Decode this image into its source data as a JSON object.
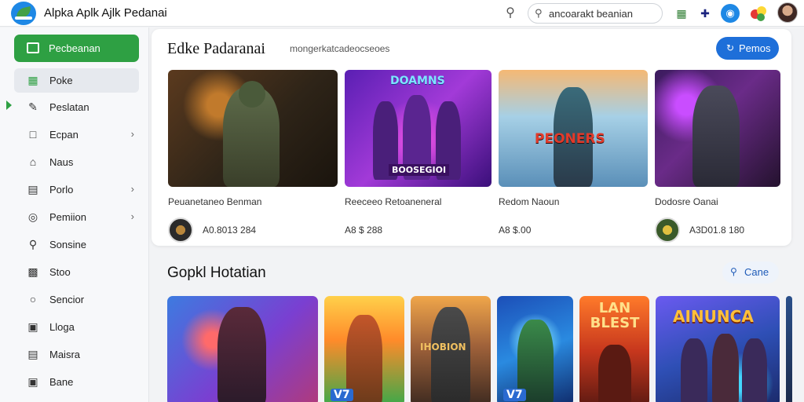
{
  "app": {
    "title": "Alpka Aplk Ajlk Pedanai"
  },
  "topbar": {
    "search_placeholder": "ancoarakt beanian",
    "icons": [
      "search-icon",
      "chart-icon",
      "move-icon",
      "app-circle-icon",
      "colors-icon"
    ],
    "accent": "#1e88e5"
  },
  "sidebar": {
    "primary": {
      "label": "Pecbeanan",
      "color": "#2ea043"
    },
    "items": [
      {
        "label": "Poke",
        "icon": "grid-icon",
        "active": true,
        "chevron": false
      },
      {
        "label": "Peslatan",
        "icon": "edit-icon",
        "active": false,
        "chevron": false
      },
      {
        "label": "Ecpan",
        "icon": "doc-icon",
        "active": false,
        "chevron": true
      },
      {
        "label": "Naus",
        "icon": "home-icon",
        "active": false,
        "chevron": false
      },
      {
        "label": "Porlo",
        "icon": "list-icon",
        "active": false,
        "chevron": true
      },
      {
        "label": "Pemiion",
        "icon": "target-icon",
        "active": false,
        "chevron": true
      },
      {
        "label": "Sonsine",
        "icon": "pin-icon",
        "active": false,
        "chevron": false
      },
      {
        "label": "Stoo",
        "icon": "building-icon",
        "active": false,
        "chevron": false
      },
      {
        "label": "Sencior",
        "icon": "user-icon",
        "active": false,
        "chevron": false
      },
      {
        "label": "Lloga",
        "icon": "image-icon",
        "active": false,
        "chevron": false
      },
      {
        "label": "Maisra",
        "icon": "file-icon",
        "active": false,
        "chevron": false
      },
      {
        "label": "Bane",
        "icon": "cube-icon",
        "active": false,
        "chevron": false
      }
    ]
  },
  "featured": {
    "title": "Edke Padaranai",
    "subtitle": "mongerkatcadeocseoes",
    "cta_label": "Pemos",
    "cards": [
      {
        "name": "Peuanetaneo Benman",
        "value": "A0.8013 284",
        "art_text": ""
      },
      {
        "name": "Reeceeo Retoaneneral",
        "value": "A8 $ 288",
        "art_text": "DOAMNS"
      },
      {
        "name": "Redom Naoun",
        "value": "A8 $.00",
        "art_text": "PEONERS"
      },
      {
        "name": "Dodosre Oanai",
        "value": "A3D01.8 180",
        "art_text": ""
      }
    ],
    "card2_banner": "BOOSEGIOI"
  },
  "section2": {
    "title": "Gopkl Hotatian",
    "button_label": "Cane",
    "tiles": [
      {
        "label": ""
      },
      {
        "label": "V7"
      },
      {
        "label": "IHOBION"
      },
      {
        "label": "V7"
      },
      {
        "label": "LAN BLEST"
      },
      {
        "label": "AINUNCA"
      },
      {
        "label": ""
      }
    ]
  }
}
